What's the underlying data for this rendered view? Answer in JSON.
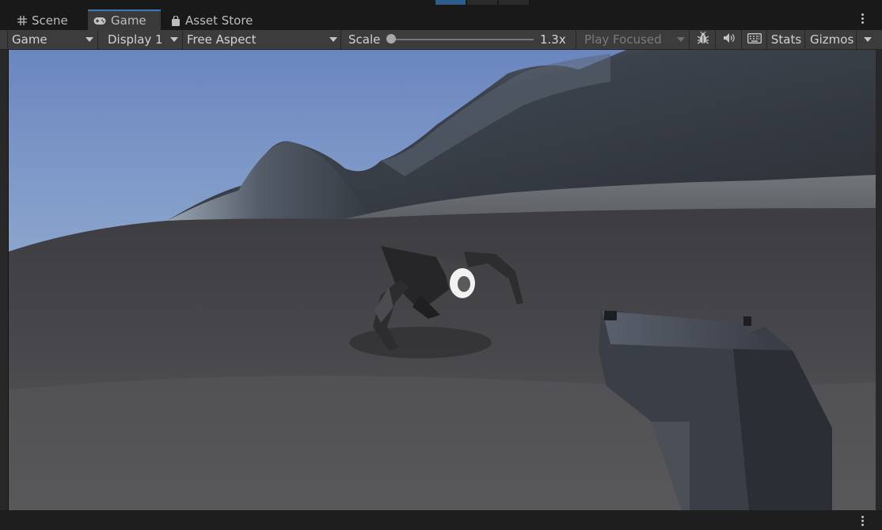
{
  "tabs": [
    {
      "label": "Scene",
      "icon": "grid-icon"
    },
    {
      "label": "Game",
      "icon": "gamepad-icon"
    },
    {
      "label": "Asset Store",
      "icon": "shopping-bag-icon"
    }
  ],
  "toolbar": {
    "game_mode": "Game",
    "display": "Display 1",
    "aspect": "Free Aspect",
    "scale_label": "Scale",
    "scale_value": "1.3x",
    "scale_level": 0.0,
    "play_mode": "Play Focused",
    "stats_label": "Stats",
    "gizmos_label": "Gizmos",
    "icons": [
      "bug-icon",
      "speaker-icon",
      "keyboard-icon"
    ]
  },
  "colors": {
    "accent": "#3a79bb",
    "panel": "#3c3c3c",
    "background": "#191919",
    "sky_top": "#6a86bf",
    "sky_horizon": "#cfdcea",
    "ground": "#4a4a4d"
  }
}
